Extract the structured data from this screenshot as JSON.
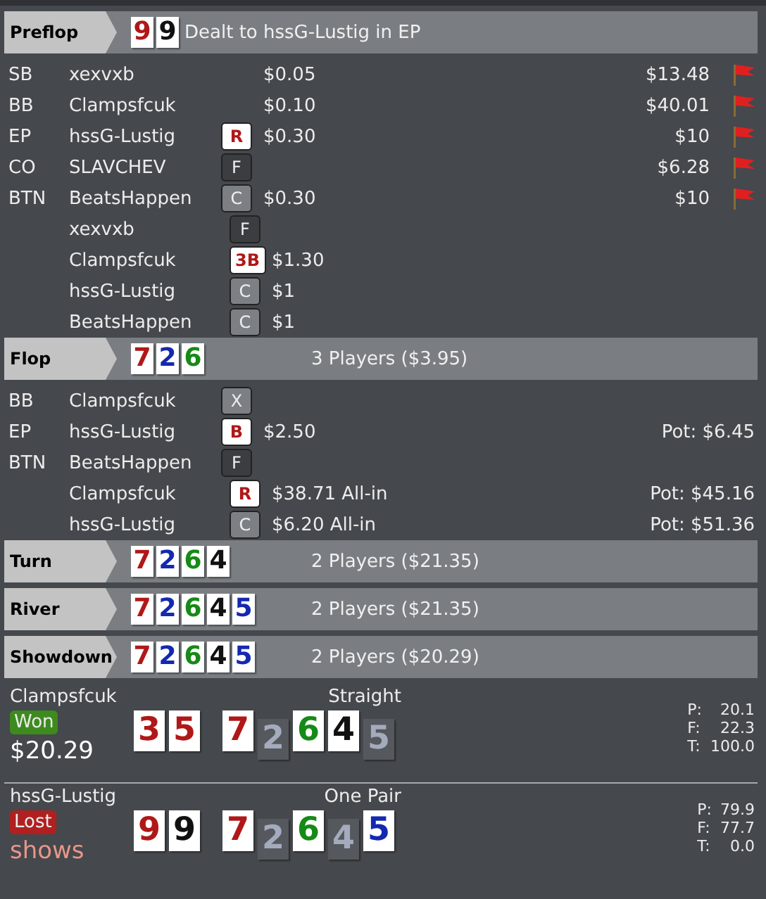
{
  "streets": [
    {
      "name": "Preflop",
      "cards": [
        {
          "rank": "9",
          "color": "#b01818"
        },
        {
          "rank": "9",
          "color": "#111111"
        }
      ],
      "summary": "Dealt to hssG-Lustig in EP",
      "rows": [
        {
          "position": "SB",
          "player": "xexvxb",
          "amount": "$0.05",
          "stack": "$13.48",
          "flagged": true
        },
        {
          "position": "BB",
          "player": "Clampsfcuk",
          "amount": "$0.10",
          "stack": "$40.01",
          "flagged": true
        },
        {
          "position": "EP",
          "player": "hssG-Lustig",
          "action": {
            "label": "R",
            "kind": "aggressive"
          },
          "amount": "$0.30",
          "stack": "$10",
          "flagged": true
        },
        {
          "position": "CO",
          "player": "SLAVCHEV",
          "action": {
            "label": "F",
            "kind": "fold"
          },
          "stack": "$6.28",
          "flagged": true
        },
        {
          "position": "BTN",
          "player": "BeatsHappen",
          "action": {
            "label": "C",
            "kind": "passive"
          },
          "amount": "$0.30",
          "stack": "$10",
          "flagged": true
        },
        {
          "player": "xexvxb",
          "action": {
            "label": "F",
            "kind": "fold"
          }
        },
        {
          "player": "Clampsfcuk",
          "action": {
            "label": "3B",
            "kind": "aggressive"
          },
          "amount": "$1.30"
        },
        {
          "player": "hssG-Lustig",
          "action": {
            "label": "C",
            "kind": "passive"
          },
          "amount": "$1"
        },
        {
          "player": "BeatsHappen",
          "action": {
            "label": "C",
            "kind": "passive"
          },
          "amount": "$1"
        }
      ]
    },
    {
      "name": "Flop",
      "cards": [
        {
          "rank": "7",
          "color": "#b01818"
        },
        {
          "rank": "2",
          "color": "#1428b0"
        },
        {
          "rank": "6",
          "color": "#168a16"
        }
      ],
      "summary": "3 Players ($3.95)",
      "rows": [
        {
          "position": "BB",
          "player": "Clampsfcuk",
          "action": {
            "label": "X",
            "kind": "passive"
          }
        },
        {
          "position": "EP",
          "player": "hssG-Lustig",
          "action": {
            "label": "B",
            "kind": "aggressive"
          },
          "amount": "$2.50",
          "pot": "Pot: $6.45"
        },
        {
          "position": "BTN",
          "player": "BeatsHappen",
          "action": {
            "label": "F",
            "kind": "fold"
          }
        },
        {
          "player": "Clampsfcuk",
          "action": {
            "label": "R",
            "kind": "aggressive"
          },
          "amount": "$38.71 All-in",
          "pot": "Pot: $45.16"
        },
        {
          "player": "hssG-Lustig",
          "action": {
            "label": "C",
            "kind": "passive"
          },
          "amount": "$6.20 All-in",
          "pot": "Pot: $51.36"
        }
      ]
    },
    {
      "name": "Turn",
      "cards": [
        {
          "rank": "7",
          "color": "#b01818"
        },
        {
          "rank": "2",
          "color": "#1428b0"
        },
        {
          "rank": "6",
          "color": "#168a16"
        },
        {
          "rank": "4",
          "color": "#111111"
        }
      ],
      "summary": "2 Players ($21.35)"
    },
    {
      "name": "River",
      "cards": [
        {
          "rank": "7",
          "color": "#b01818"
        },
        {
          "rank": "2",
          "color": "#1428b0"
        },
        {
          "rank": "6",
          "color": "#168a16"
        },
        {
          "rank": "4",
          "color": "#111111"
        },
        {
          "rank": "5",
          "color": "#1428b0"
        }
      ],
      "summary": "2 Players ($21.35)"
    },
    {
      "name": "Showdown",
      "cards": [
        {
          "rank": "7",
          "color": "#b01818"
        },
        {
          "rank": "2",
          "color": "#1428b0"
        },
        {
          "rank": "6",
          "color": "#168a16"
        },
        {
          "rank": "4",
          "color": "#111111"
        },
        {
          "rank": "5",
          "color": "#1428b0"
        }
      ],
      "summary": "2 Players ($20.29)"
    }
  ],
  "showdown": [
    {
      "player": "Clampsfcuk",
      "result": {
        "label": "Won",
        "kind": "won"
      },
      "detail": "$20.29",
      "hand": "Straight",
      "hole": [
        {
          "rank": "3",
          "color": "#b01818",
          "used": true
        },
        {
          "rank": "5",
          "color": "#b01818",
          "used": true
        }
      ],
      "board": [
        {
          "rank": "7",
          "color": "#b01818",
          "used": true
        },
        {
          "rank": "2",
          "used": false
        },
        {
          "rank": "6",
          "color": "#168a16",
          "used": true
        },
        {
          "rank": "4",
          "color": "#111111",
          "used": true
        },
        {
          "rank": "5",
          "used": false
        }
      ],
      "stats": [
        {
          "label": "P:",
          "value": "20.1"
        },
        {
          "label": "F:",
          "value": "22.3"
        },
        {
          "label": "T:",
          "value": "100.0"
        }
      ]
    },
    {
      "player": "hssG-Lustig",
      "result": {
        "label": "Lost",
        "kind": "lost"
      },
      "detail": "shows",
      "hand": "One Pair",
      "hole": [
        {
          "rank": "9",
          "color": "#b01818",
          "used": true
        },
        {
          "rank": "9",
          "color": "#111111",
          "used": true
        }
      ],
      "board": [
        {
          "rank": "7",
          "color": "#b01818",
          "used": true
        },
        {
          "rank": "2",
          "used": false
        },
        {
          "rank": "6",
          "color": "#168a16",
          "used": true
        },
        {
          "rank": "4",
          "used": false
        },
        {
          "rank": "5",
          "color": "#1428b0",
          "used": true
        }
      ],
      "stats": [
        {
          "label": "P:",
          "value": "79.9"
        },
        {
          "label": "F:",
          "value": "77.7"
        },
        {
          "label": "T:",
          "value": "0.0"
        }
      ]
    }
  ]
}
